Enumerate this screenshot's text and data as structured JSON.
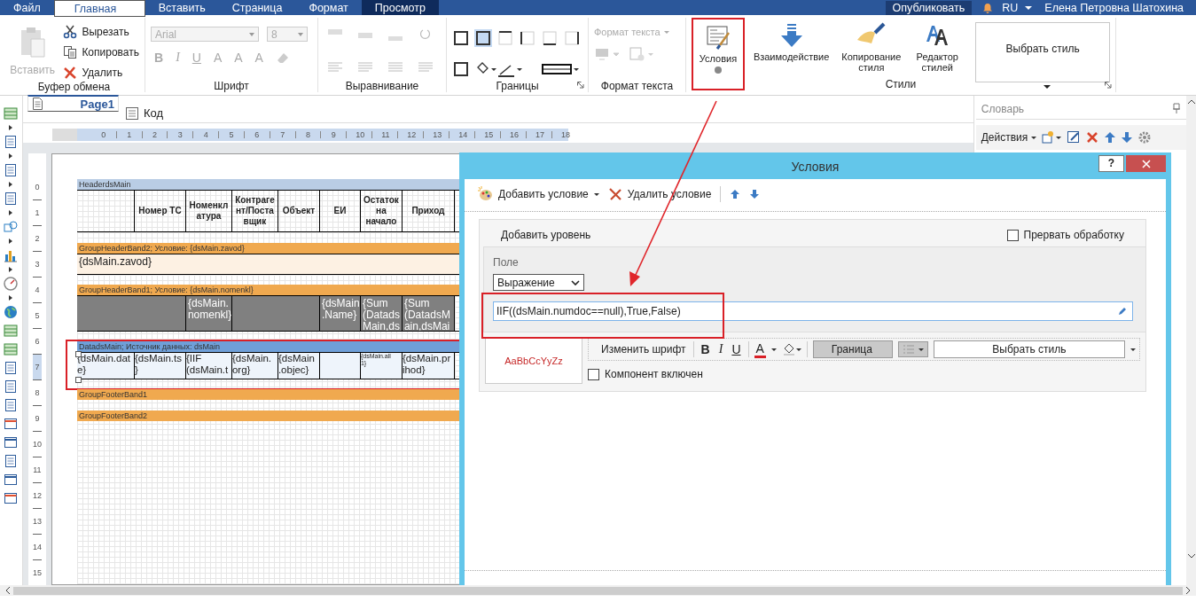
{
  "menu": {
    "tabs": [
      {
        "label": "Файл",
        "selected": false,
        "hovered": false
      },
      {
        "label": "Главная",
        "selected": true,
        "hovered": false
      },
      {
        "label": "Вставить",
        "selected": false,
        "hovered": false
      },
      {
        "label": "Страница",
        "selected": false,
        "hovered": false
      },
      {
        "label": "Формат",
        "selected": false,
        "hovered": false
      },
      {
        "label": "Просмотр",
        "selected": false,
        "hovered": true
      }
    ],
    "publish": "Опубликовать",
    "language": "RU",
    "user": "Елена Петровна Шатохина"
  },
  "ribbon": {
    "clipboard": {
      "title": "Буфер обмена",
      "paste": {
        "label": "Вставить",
        "disabled": true
      },
      "actions": [
        {
          "label": "Вырезать",
          "kind": "cut"
        },
        {
          "label": "Копировать",
          "kind": "copy"
        },
        {
          "label": "Удалить",
          "kind": "delete"
        }
      ]
    },
    "font": {
      "title": "Шрифт",
      "family": "Arial",
      "size": "8",
      "disabled": true,
      "buttons": [
        "B",
        "I",
        "U",
        "A",
        "A",
        "A"
      ]
    },
    "alignment": {
      "title": "Выравнивание"
    },
    "borders": {
      "title": "Границы"
    },
    "text_format": {
      "title": "Формат текста",
      "dropdown": "Формат текста",
      "disabled": true
    },
    "styles": {
      "title": "Стили",
      "buttons": [
        {
          "label": "Условия",
          "kind": "conditions",
          "highlighted": true
        },
        {
          "label": "Взаимодействие",
          "kind": "interaction",
          "highlighted": false
        },
        {
          "label": "Копирование стиля",
          "kind": "copy_style",
          "highlighted": false
        },
        {
          "label": "Редактор стилей",
          "kind": "style_editor",
          "highlighted": false
        }
      ],
      "style_picker": "Выбрать стиль"
    }
  },
  "designer": {
    "tabs": [
      {
        "label": "Page1",
        "selected": true,
        "kind": "page"
      },
      {
        "label": "Код",
        "selected": false,
        "kind": "code"
      }
    ],
    "ruler": [
      "0",
      "1",
      "2",
      "3",
      "4",
      "5",
      "6",
      "7",
      "8",
      "9",
      "10",
      "11",
      "12",
      "13",
      "14",
      "15",
      "16",
      "17",
      "18"
    ],
    "row_ruler": [
      "0",
      "1",
      "2",
      "3",
      "4",
      "5",
      "6",
      "7",
      "8",
      "9",
      "10",
      "11",
      "12",
      "13",
      "14",
      "15"
    ],
    "bands": [
      {
        "title": "HeaderdsMain",
        "kind": "header",
        "highlighted": false,
        "cells": [
          {
            "kind": "empty"
          },
          {
            "kind": "field",
            "text": "Номер ТС"
          },
          {
            "kind": "field",
            "text": "Номенкл\nатура"
          },
          {
            "kind": "field",
            "text": "Контраге\nнт/Поста\nвщик"
          },
          {
            "kind": "field",
            "text": "Объект"
          },
          {
            "kind": "field",
            "text": "ЕИ"
          },
          {
            "kind": "field",
            "text": "Остаток\nна\nначало"
          },
          {
            "kind": "field",
            "text": "Приход"
          }
        ]
      },
      {
        "title": "GroupHeaderBand2; Условие: {dsMain.zavod}",
        "kind": "group_header",
        "highlighted": false,
        "cells": [
          {
            "kind": "field",
            "text": "{dsMain.zavod}"
          }
        ]
      },
      {
        "title": "GroupHeaderBand1; Условие: {dsMain.nomenkl}",
        "kind": "group_header",
        "highlighted": false,
        "cells": [
          {
            "kind": "empty"
          },
          {
            "kind": "field",
            "text": "{dsMain.\nnomenkl}"
          },
          {
            "kind": "empty"
          },
          {
            "kind": "field",
            "text": "{dsMain\n.Name}"
          },
          {
            "kind": "field",
            "text": "{Sum\n(Datads\nMain,ds"
          },
          {
            "kind": "field",
            "text": "{Sum\n(DatadsM\nain,dsMai"
          }
        ]
      },
      {
        "title": "DatadsMain; Источник данных: dsMain",
        "kind": "data",
        "highlighted": true,
        "cells": [
          {
            "kind": "field",
            "text": "{dsMain.dat\ne}"
          },
          {
            "kind": "field",
            "text": "{dsMain.ts\n}"
          },
          {
            "kind": "field",
            "text": "{IIF\n(dsMain.t"
          },
          {
            "kind": "field",
            "text": "{dsMain.\norg}"
          },
          {
            "kind": "field",
            "text": "{dsMain\n.objec}"
          },
          {
            "kind": "empty"
          },
          {
            "kind": "small_field",
            "text": "{dsMain.all\n1}"
          },
          {
            "kind": "field",
            "text": "{dsMain.pr\nihod}"
          }
        ]
      },
      {
        "title": "GroupFooterBand1",
        "kind": "group_footer",
        "highlighted": false
      },
      {
        "title": "GroupFooterBand2",
        "kind": "group_footer",
        "highlighted": false
      }
    ]
  },
  "dictionary": {
    "title": "Словарь",
    "actions": "Действия"
  },
  "conditions_dialog": {
    "title": "Условия",
    "help": "?",
    "toolbar": {
      "add": "Добавить условие",
      "remove": "Удалить условие"
    },
    "add_level": "Добавить уровень",
    "break_processing": {
      "label": "Прервать обработку",
      "checked": false
    },
    "field_label": "Поле",
    "field_type": "Выражение",
    "expression": {
      "value": "IIF((dsMain.numdoc==null),True,False)",
      "highlighted": true
    },
    "preview": "AaBbCcYyZz",
    "format_toolbar": {
      "change_font": "Изменить шрифт",
      "bold": "B",
      "italic": "I",
      "underline": "U",
      "font_color": "A",
      "border": "Граница",
      "style": "Выбрать стиль"
    },
    "component_enabled": {
      "label": "Компонент включен",
      "checked": false
    }
  }
}
